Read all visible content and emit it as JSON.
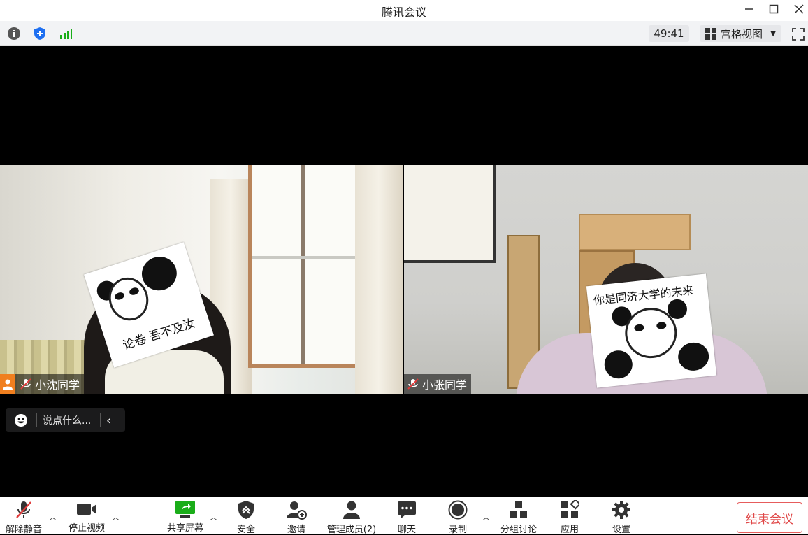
{
  "window": {
    "title": "腾讯会议",
    "controls": [
      "minimize",
      "maximize",
      "close"
    ]
  },
  "infobar": {
    "icons": [
      "info-icon",
      "shield-icon",
      "signal-icon"
    ],
    "timer": "49:41",
    "view_label": "宫格视图",
    "fullscreen": "fullscreen-icon"
  },
  "participants": [
    {
      "name": "小沈同学",
      "muted": true,
      "host": true,
      "sticker_text": "论卷 吾不及汝"
    },
    {
      "name": "小张同学",
      "muted": true,
      "host": false,
      "sticker_text": "你是同济大学的未来"
    }
  ],
  "chat": {
    "placeholder": "说点什么..."
  },
  "toolbar": {
    "items": [
      {
        "label": "解除静音",
        "icon": "mic-muted-icon"
      },
      {
        "label": "停止视频",
        "icon": "video-camera-icon"
      },
      {
        "label": "共享屏幕",
        "icon": "share-screen-icon"
      },
      {
        "label": "安全",
        "icon": "security-icon"
      },
      {
        "label": "邀请",
        "icon": "invite-icon"
      },
      {
        "label": "管理成员(2)",
        "icon": "members-icon"
      },
      {
        "label": "聊天",
        "icon": "chat-icon"
      },
      {
        "label": "录制",
        "icon": "record-icon"
      },
      {
        "label": "分组讨论",
        "icon": "breakout-icon"
      },
      {
        "label": "应用",
        "icon": "apps-icon"
      },
      {
        "label": "设置",
        "icon": "settings-icon"
      }
    ],
    "end_label": "结束会议"
  },
  "colors": {
    "accent_green": "#1aad19",
    "accent_blue": "#1e6ff1",
    "host_orange": "#f07f1f",
    "end_red": "#e04848"
  }
}
